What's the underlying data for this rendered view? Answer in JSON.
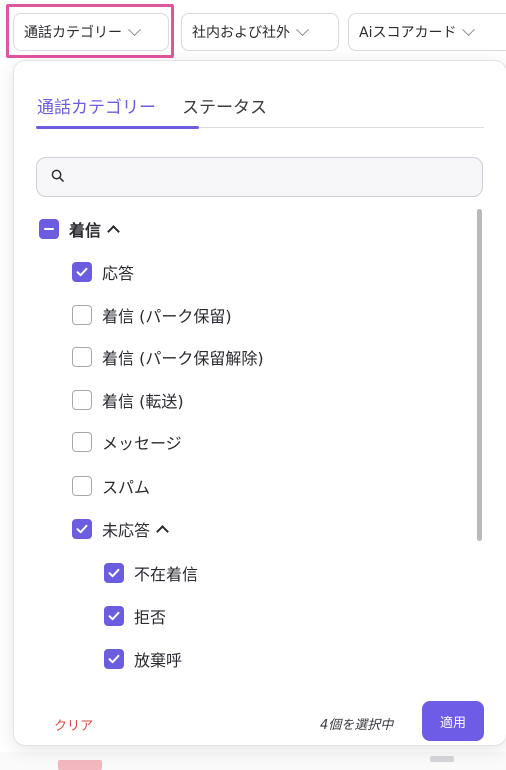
{
  "filters": {
    "chips": [
      {
        "label": "通話カテゴリー"
      },
      {
        "label": "社内および社外"
      },
      {
        "label": "Aiスコアカード"
      }
    ]
  },
  "popover": {
    "tabs": [
      {
        "label": "通話カテゴリー"
      },
      {
        "label": "ステータス"
      }
    ],
    "search": {
      "placeholder": "",
      "value": ""
    },
    "items": [
      {
        "label": "着信",
        "state": "indeterminate",
        "expanded": true
      },
      {
        "label": "応答",
        "state": "checked"
      },
      {
        "label": "着信 (パーク保留)",
        "state": "unchecked"
      },
      {
        "label": "着信 (パーク保留解除)",
        "state": "unchecked"
      },
      {
        "label": "着信 (転送)",
        "state": "unchecked"
      },
      {
        "label": "メッセージ",
        "state": "unchecked"
      },
      {
        "label": "スパム",
        "state": "unchecked"
      },
      {
        "label": "未応答",
        "state": "checked",
        "expanded": true
      },
      {
        "label": "不在着信",
        "state": "checked"
      },
      {
        "label": "拒否",
        "state": "checked"
      },
      {
        "label": "放棄呼",
        "state": "checked"
      }
    ],
    "footer": {
      "clear_label": "クリア",
      "selected_count_label": "4個を選択中",
      "apply_label": "適用"
    }
  },
  "colors": {
    "accent": "#6b5ce0",
    "highlight_frame": "#e0569e",
    "clear_text": "#e0463d"
  }
}
